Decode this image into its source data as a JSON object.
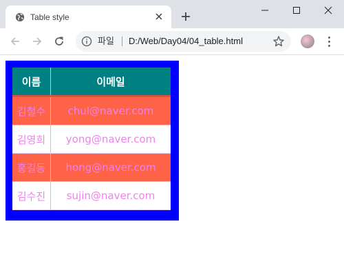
{
  "tab": {
    "title": "Table style"
  },
  "omnibox": {
    "site_label": "파일",
    "url": "D:/Web/Day04/04_table.html"
  },
  "table": {
    "headers": [
      "이름",
      "이메일"
    ],
    "rows": [
      [
        "김철수",
        "chul@naver.com"
      ],
      [
        "김영희",
        "yong@naver.com"
      ],
      [
        "홍길동",
        "hong@naver.com"
      ],
      [
        "김수진",
        "sujin@naver.com"
      ]
    ]
  },
  "colors": {
    "header_bg": "#008080",
    "odd_row_bg": "#ff6347",
    "even_row_bg": "#ffffff",
    "cell_text": "#ee82ee",
    "table_border": "#0000ff"
  }
}
